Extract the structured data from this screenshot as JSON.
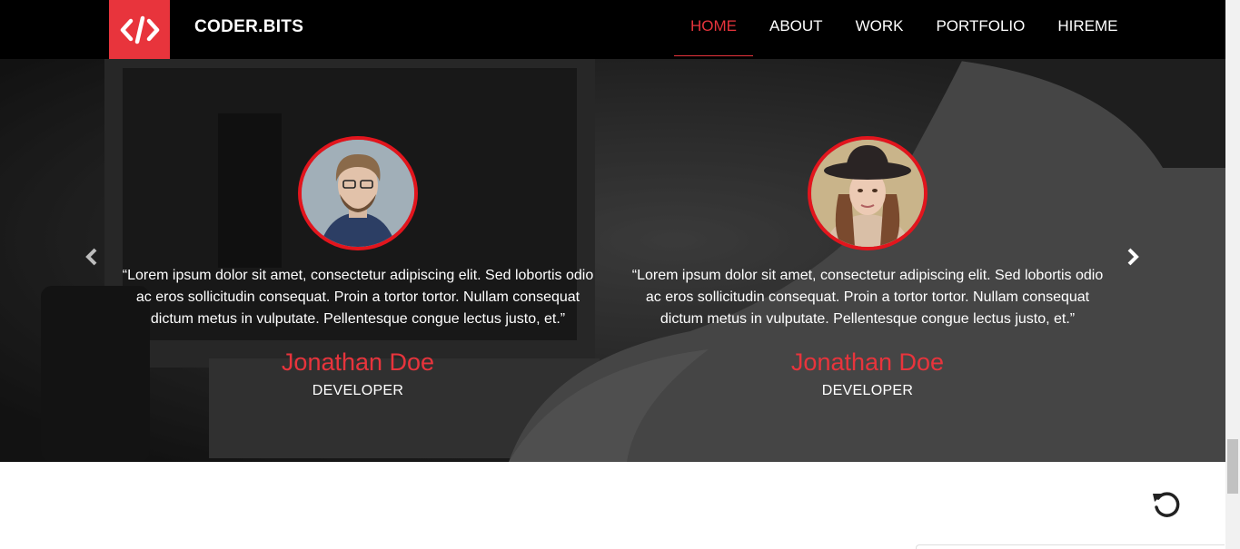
{
  "brand": {
    "name": "CODER.BITS",
    "logo_icon": "code-brackets-icon",
    "accent": "#e8343c"
  },
  "nav": {
    "items": [
      {
        "label": "HOME",
        "active": true
      },
      {
        "label": "ABOUT",
        "active": false
      },
      {
        "label": "WORK",
        "active": false
      },
      {
        "label": "PORTFOLIO",
        "active": false
      },
      {
        "label": "HIREME",
        "active": false
      }
    ]
  },
  "testimonials": [
    {
      "quote": "“Lorem ipsum dolor sit amet, consectetur adipiscing elit. Sed lobortis odio ac eros sollicitudin consequat. Proin a tortor tortor. Nullam consequat dictum metus in vulputate. Pellentesque congue lectus justo, et.”",
      "name": "Jonathan Doe",
      "role": "DEVELOPER"
    },
    {
      "quote": "“Lorem ipsum dolor sit amet, consectetur adipiscing elit. Sed lobortis odio ac eros sollicitudin consequat. Proin a tortor tortor. Nullam consequat dictum metus in vulputate. Pellentesque congue lectus justo, et.”",
      "name": "Jonathan Doe",
      "role": "DEVELOPER"
    }
  ],
  "controls": {
    "prev_icon": "chevron-left-icon",
    "next_icon": "chevron-right-icon",
    "reload_icon": "reload-icon"
  },
  "colors": {
    "navbar": "#000000",
    "avatar_ring": "#e2151d",
    "name_text": "#e8343c"
  }
}
